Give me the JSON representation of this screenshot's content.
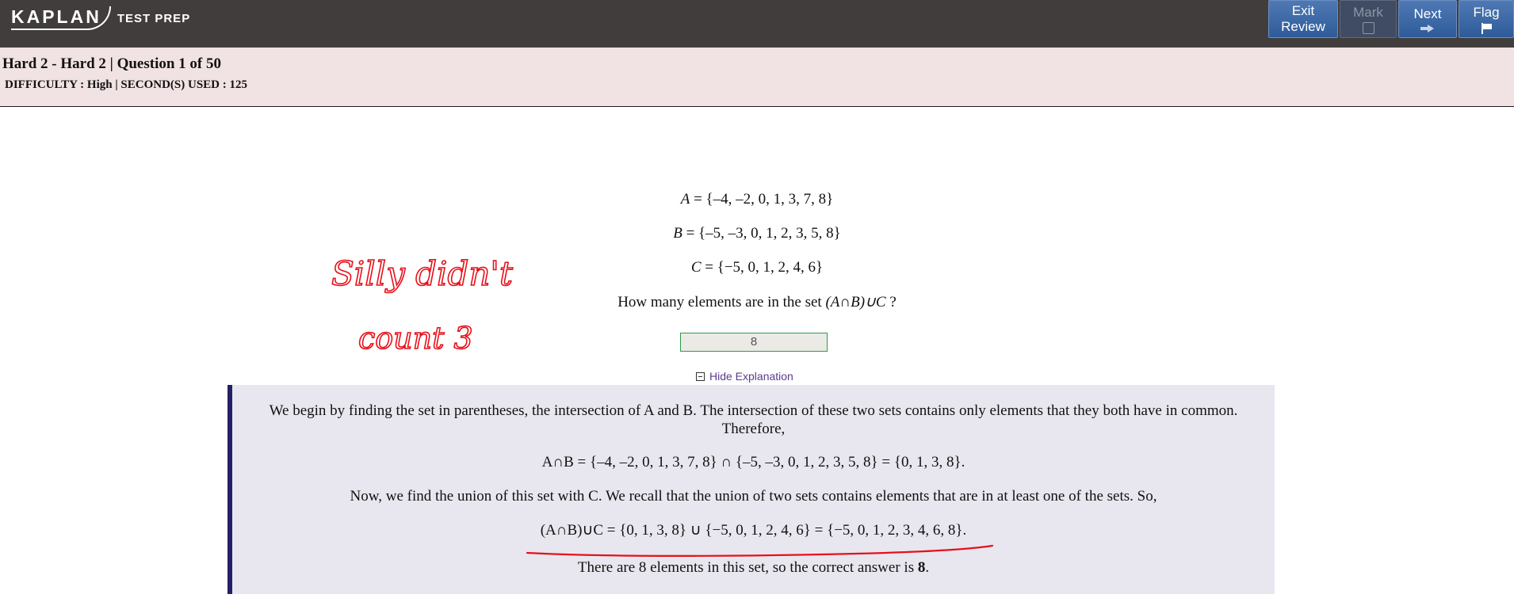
{
  "header": {
    "logo_text": "KAPLAN",
    "logo_sub": "TEST PREP",
    "buttons": {
      "exit_line1": "Exit",
      "exit_line2": "Review",
      "mark": "Mark",
      "next": "Next",
      "flag": "Flag"
    }
  },
  "info": {
    "title": "Hard 2 - Hard 2 | Question 1 of 50",
    "difficulty_label": "DIFFICULTY : ",
    "difficulty_value": "High",
    "seconds_label": " | SECOND(S) USED : ",
    "seconds_value": "125"
  },
  "question": {
    "set_a_name": "A",
    "set_a": " = {–4, –2, 0, 1, 3, 7, 8}",
    "set_b_name": "B",
    "set_b": " = {–5, –3, 0, 1, 2, 3, 5, 8}",
    "set_c_name": "C",
    "set_c": " = {−5, 0, 1, 2, 4, 6}",
    "prompt": "How many elements are in the set ",
    "prompt_expr": "(A∩B)∪C",
    "prompt_end": " ?",
    "answer": "8"
  },
  "toggle": {
    "label": "Hide Explanation",
    "icon": "minus-box-icon"
  },
  "explanation": {
    "p1_line1": "We begin by finding the set in parentheses, the intersection of A and B. The intersection of these two sets contains only elements that they both have in common.",
    "p1_line2": "Therefore,",
    "eq1": "A∩B = {–4, –2, 0, 1, 3, 7, 8} ∩ {–5, –3, 0, 1, 2, 3, 5, 8} = {0, 1, 3, 8}.",
    "p2": "Now, we find the union of this set with C. We recall that the union of two sets contains elements that are in at least one of the sets. So,",
    "eq2": "(A∩B)∪C = {0, 1, 3, 8} ∪ {−5, 0, 1, 2, 4, 6} = {−5, 0, 1, 2, 3, 4, 6, 8}.",
    "conclusion": "There are 8 elements in this set, so the correct answer is ",
    "conclusion_answer": "8",
    "conclusion_end": "."
  },
  "annotation": {
    "text_line1": "Silly didn't",
    "text_line2": "count 3",
    "color": "#e8101a"
  },
  "colors": {
    "topbar": "#413d3c",
    "infobar": "#f1e2e4",
    "button": "#3d6aa8",
    "explanation_bg": "#e8e7ef",
    "explanation_border": "#241f66"
  }
}
